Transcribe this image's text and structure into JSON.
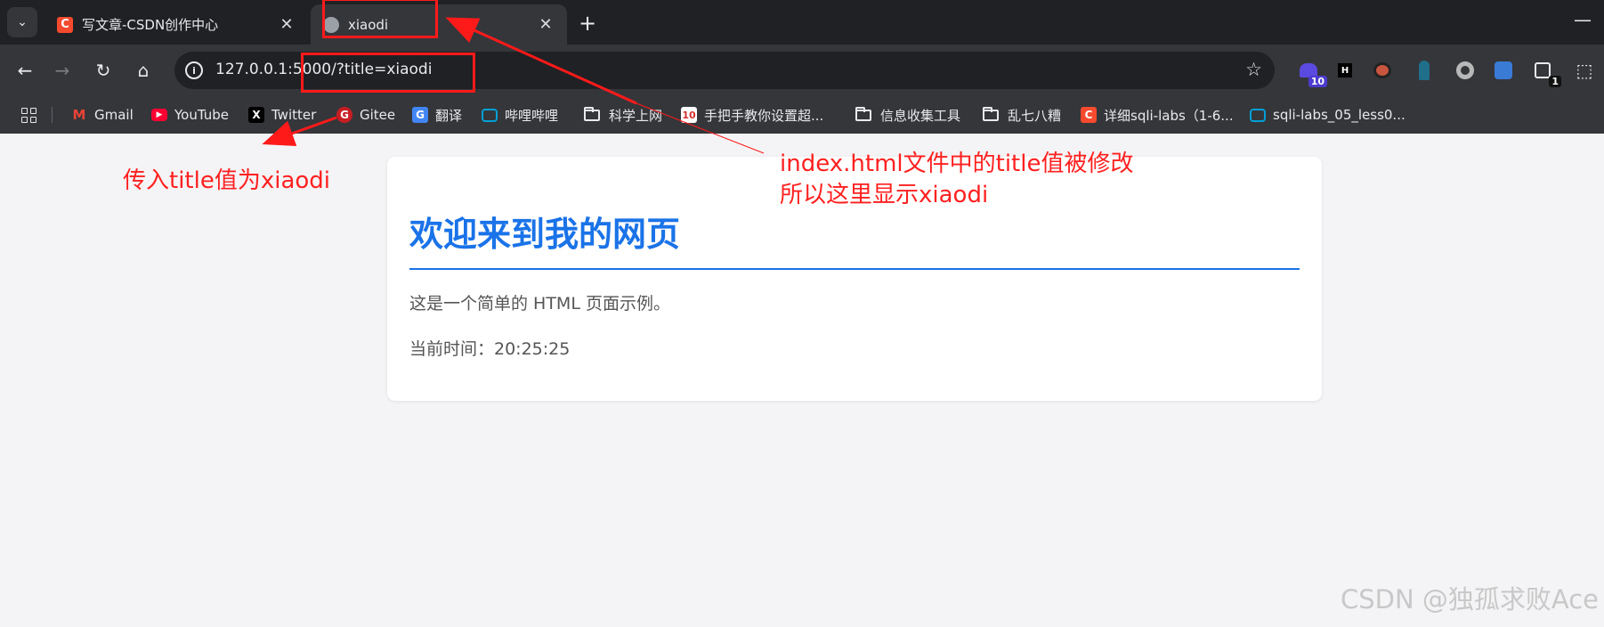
{
  "tabs": [
    {
      "title": "写文章-CSDN创作中心",
      "favicon": "csdn-icon",
      "active": false
    },
    {
      "title": "xiaodi",
      "favicon": "globe-icon",
      "active": true
    }
  ],
  "toolbar": {
    "url": "127.0.0.1:5000/?title=xiaodi",
    "extensions": [
      {
        "name": "extension-purple-hat-icon",
        "badge": "10"
      },
      {
        "name": "extension-h-icon",
        "badge": ""
      },
      {
        "name": "extension-mask-icon",
        "badge": ""
      },
      {
        "name": "extension-figure-icon",
        "badge": ""
      },
      {
        "name": "extension-circle-icon",
        "badge": ""
      },
      {
        "name": "extension-bird-icon",
        "badge": ""
      },
      {
        "name": "extension-puzzle-badge-icon",
        "badge": "1"
      },
      {
        "name": "extensions-puzzle-icon",
        "badge": ""
      }
    ]
  },
  "bookmarks": [
    {
      "label": "Gmail",
      "icon": "gmail-icon"
    },
    {
      "label": "YouTube",
      "icon": "youtube-icon"
    },
    {
      "label": "Twitter",
      "icon": "x-icon"
    },
    {
      "label": "Gitee",
      "icon": "gitee-icon"
    },
    {
      "label": "翻译",
      "icon": "translate-icon"
    },
    {
      "label": "哔哩哔哩",
      "icon": "bilibili-icon"
    },
    {
      "label": "科学上网",
      "icon": "folder-icon"
    },
    {
      "label": "手把手教你设置超...",
      "icon": "ten-icon"
    },
    {
      "label": "信息收集工具",
      "icon": "folder-icon"
    },
    {
      "label": "乱七八糟",
      "icon": "folder-icon"
    },
    {
      "label": "详细sqli-labs（1-6...",
      "icon": "csdn-icon"
    },
    {
      "label": "sqli-labs_05_less0...",
      "icon": "bilibili-icon"
    }
  ],
  "page": {
    "heading": "欢迎来到我的网页",
    "paragraph": "这是一个简单的 HTML 页面示例。",
    "time_text": "当前时间：20:25:25"
  },
  "annotations": {
    "left_note": "传入title值为xiaodi",
    "right_note_line1": "index.html文件中的title值被修改",
    "right_note_line2": "所以这里显示xiaodi"
  },
  "watermark": "CSDN @独孤求败Ace",
  "colors": {
    "accent": "#1a73e8",
    "annotation": "#ff1a1a",
    "browser_dark": "#202124",
    "toolbar": "#35363a"
  }
}
